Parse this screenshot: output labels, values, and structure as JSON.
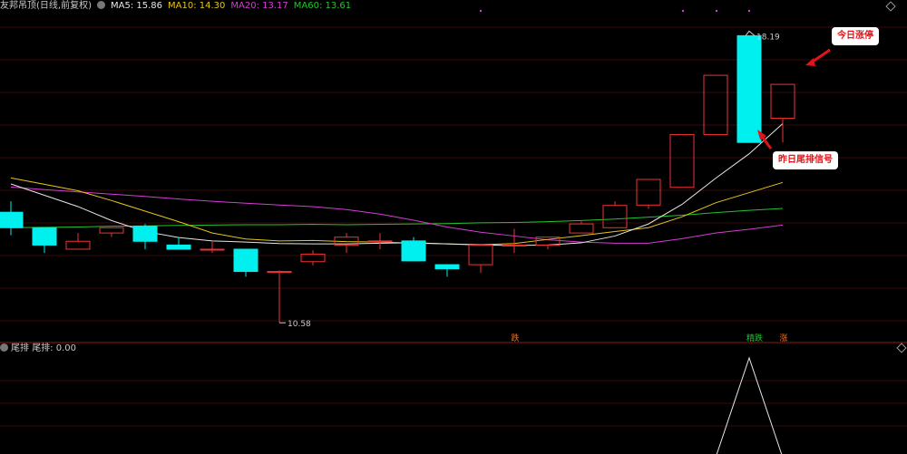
{
  "header": {
    "title": "友邦吊顶(日线,前复权)",
    "ma5_label": "MA5: 15.86",
    "ma10_label": "MA10: 14.30",
    "ma20_label": "MA20: 13.17",
    "ma60_label": "MA60: 13.61"
  },
  "subpanel": {
    "name": "尾排",
    "value_label": "尾排: 0.00"
  },
  "annotations": {
    "today_limit_up": "今日涨停",
    "yesterday_signal": "昨日尾排信号",
    "high_label": "18.19",
    "low_label": "10.58",
    "marker_a": "跌",
    "marker_b": "精跌",
    "marker_c": "涨"
  },
  "colors": {
    "up": "#e33",
    "down": "#00f0f0",
    "ma5": "#e6e6e6",
    "ma10": "#e6c619",
    "ma20": "#d43cd4",
    "ma60": "#22c42f",
    "grid": "#3a0a0a"
  },
  "chart_data": {
    "type": "candlestick",
    "ylim": [
      10.2,
      18.8
    ],
    "candles": [
      {
        "o": 13.51,
        "c": 13.1,
        "h": 13.8,
        "l": 12.9
      },
      {
        "o": 13.1,
        "c": 12.64,
        "h": 13.1,
        "l": 12.43
      },
      {
        "o": 12.53,
        "c": 12.74,
        "h": 12.96,
        "l": 12.53
      },
      {
        "o": 12.96,
        "c": 13.1,
        "h": 13.1,
        "l": 12.85
      },
      {
        "o": 13.14,
        "c": 12.74,
        "h": 13.2,
        "l": 12.53
      },
      {
        "o": 12.64,
        "c": 12.53,
        "h": 12.85,
        "l": 12.53
      },
      {
        "o": 12.53,
        "c": 12.53,
        "h": 12.75,
        "l": 12.43
      },
      {
        "o": 12.53,
        "c": 11.94,
        "h": 12.53,
        "l": 11.8
      },
      {
        "o": 11.94,
        "c": 11.94,
        "h": 11.97,
        "l": 10.58
      },
      {
        "o": 12.2,
        "c": 12.4,
        "h": 12.5,
        "l": 12.1
      },
      {
        "o": 12.64,
        "c": 12.85,
        "h": 12.96,
        "l": 12.43
      },
      {
        "o": 12.75,
        "c": 12.75,
        "h": 12.96,
        "l": 12.53
      },
      {
        "o": 12.75,
        "c": 12.22,
        "h": 12.85,
        "l": 12.22
      },
      {
        "o": 12.12,
        "c": 12.01,
        "h": 12.12,
        "l": 11.8
      },
      {
        "o": 12.12,
        "c": 12.64,
        "h": 12.64,
        "l": 11.9
      },
      {
        "o": 12.64,
        "c": 12.64,
        "h": 13.07,
        "l": 12.43
      },
      {
        "o": 12.64,
        "c": 12.85,
        "h": 12.85,
        "l": 12.53
      },
      {
        "o": 12.96,
        "c": 13.2,
        "h": 13.27,
        "l": 12.96
      },
      {
        "o": 13.1,
        "c": 13.69,
        "h": 13.8,
        "l": 13.1
      },
      {
        "o": 13.7,
        "c": 14.38,
        "h": 14.38,
        "l": 13.6
      },
      {
        "o": 14.17,
        "c": 15.57,
        "h": 15.57,
        "l": 14.17
      },
      {
        "o": 15.57,
        "c": 17.14,
        "h": 17.14,
        "l": 15.57
      },
      {
        "o": 18.19,
        "c": 15.36,
        "h": 18.19,
        "l": 15.36
      },
      {
        "o": 16.0,
        "c": 16.9,
        "h": 16.9,
        "l": 15.36
      }
    ],
    "ma5": [
      14.26,
      13.96,
      13.66,
      13.29,
      13.0,
      12.84,
      12.75,
      12.72,
      12.68,
      12.67,
      12.67,
      12.69,
      12.7,
      12.67,
      12.64,
      12.63,
      12.64,
      12.7,
      12.88,
      13.2,
      13.72,
      14.41,
      15.06,
      15.86
    ],
    "ma10": [
      14.42,
      14.25,
      14.08,
      13.82,
      13.54,
      13.26,
      12.96,
      12.8,
      12.75,
      12.76,
      12.73,
      12.72,
      12.69,
      12.67,
      12.65,
      12.68,
      12.79,
      12.89,
      13.0,
      13.1,
      13.39,
      13.76,
      14.03,
      14.3
    ],
    "ma20": [
      14.18,
      14.11,
      14.05,
      13.99,
      13.93,
      13.86,
      13.8,
      13.75,
      13.7,
      13.66,
      13.58,
      13.46,
      13.3,
      13.12,
      12.98,
      12.88,
      12.78,
      12.72,
      12.69,
      12.69,
      12.81,
      12.96,
      13.06,
      13.17
    ],
    "ma60": [
      13.1,
      13.11,
      13.12,
      13.14,
      13.15,
      13.16,
      13.17,
      13.18,
      13.18,
      13.19,
      13.18,
      13.19,
      13.2,
      13.21,
      13.23,
      13.24,
      13.26,
      13.29,
      13.33,
      13.38,
      13.43,
      13.5,
      13.56,
      13.61
    ],
    "subpanel_line": [
      0,
      0,
      0,
      0,
      0,
      0,
      0,
      0,
      0,
      0,
      0,
      0,
      0,
      0,
      0,
      0,
      0,
      0,
      0,
      0,
      0,
      0,
      1,
      0
    ]
  }
}
